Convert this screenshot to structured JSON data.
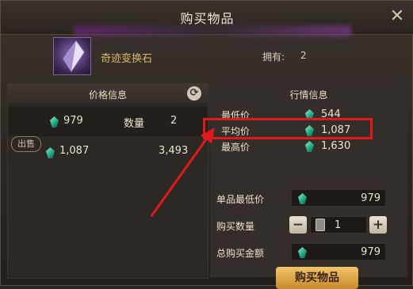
{
  "window": {
    "title": "购买物品"
  },
  "item": {
    "name": "奇迹变换石",
    "own_label": "拥有:",
    "own_value": "2"
  },
  "left_panel": {
    "title": "价格信息",
    "rows": [
      {
        "tag": "出售",
        "price": "979",
        "qty_label": "数量",
        "qty": "2"
      },
      {
        "tag": "",
        "price": "1,087",
        "qty_label": "",
        "qty": "3,493"
      }
    ]
  },
  "right_panel": {
    "title": "行情信息",
    "stats": [
      {
        "label": "最低价",
        "value": "544"
      },
      {
        "label": "平均价",
        "value": "1,087"
      },
      {
        "label": "最高价",
        "value": "1,630"
      }
    ]
  },
  "purchase": {
    "unit_low_label": "单品最低价",
    "unit_low_value": "979",
    "qty_label": "购买数量",
    "qty_value": "1",
    "total_label": "总购买金额",
    "total_value": "979",
    "buy_button": "购买物品"
  },
  "colors": {
    "highlight": "#e01a1a",
    "gem": "#1ea37e",
    "button": "#e0a84c"
  }
}
